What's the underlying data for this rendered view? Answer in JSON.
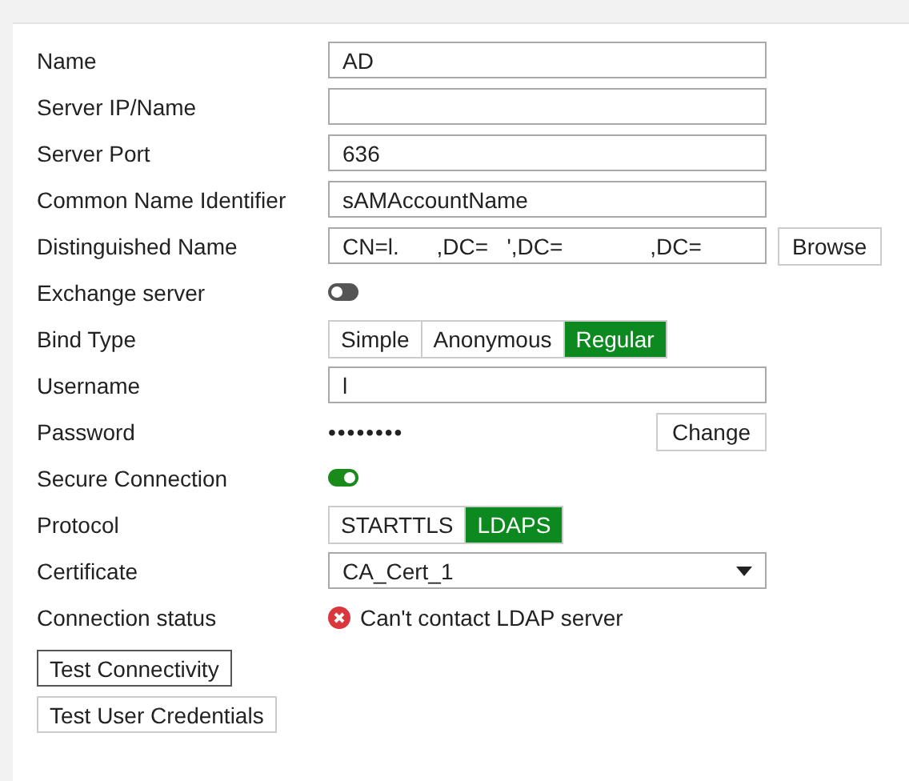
{
  "fields": [
    {
      "kind": "text",
      "label": "Name",
      "value": "AD"
    },
    {
      "kind": "text",
      "label": "Server IP/Name"
    },
    {
      "kind": "text",
      "label": "Server Port",
      "value": "636"
    },
    {
      "kind": "text",
      "label": "Common Name Identifier",
      "value": "sAMAccountName"
    },
    {
      "kind": "text",
      "label": "Distinguished Name",
      "value": "CN=l.      ,DC=   ',DC=              ,DC=",
      "button": "Browse"
    },
    {
      "kind": "toggle",
      "label": "Exchange server",
      "on": false
    },
    {
      "kind": "segmented",
      "label": "Bind Type",
      "options": [
        {
          "label": "Simple",
          "selected": false
        },
        {
          "label": "Anonymous",
          "selected": false
        },
        {
          "label": "Regular",
          "selected": true
        }
      ]
    },
    {
      "kind": "text",
      "label": "Username",
      "value": "l"
    },
    {
      "kind": "password",
      "label": "Password",
      "value": "••••••••",
      "button": "Change"
    },
    {
      "kind": "toggle",
      "label": "Secure Connection",
      "on": true
    },
    {
      "kind": "segmented",
      "label": "Protocol",
      "options": [
        {
          "label": "STARTTLS",
          "selected": false
        },
        {
          "label": "LDAPS",
          "selected": true
        }
      ]
    },
    {
      "kind": "select",
      "label": "Certificate",
      "value": "CA_Cert_1"
    },
    {
      "kind": "status",
      "label": "Connection status",
      "value": "Can't contact LDAP server"
    }
  ],
  "buttons": [
    {
      "label": "Test Connectivity",
      "focused": true
    },
    {
      "label": "Test User Credentials",
      "focused": false
    }
  ]
}
